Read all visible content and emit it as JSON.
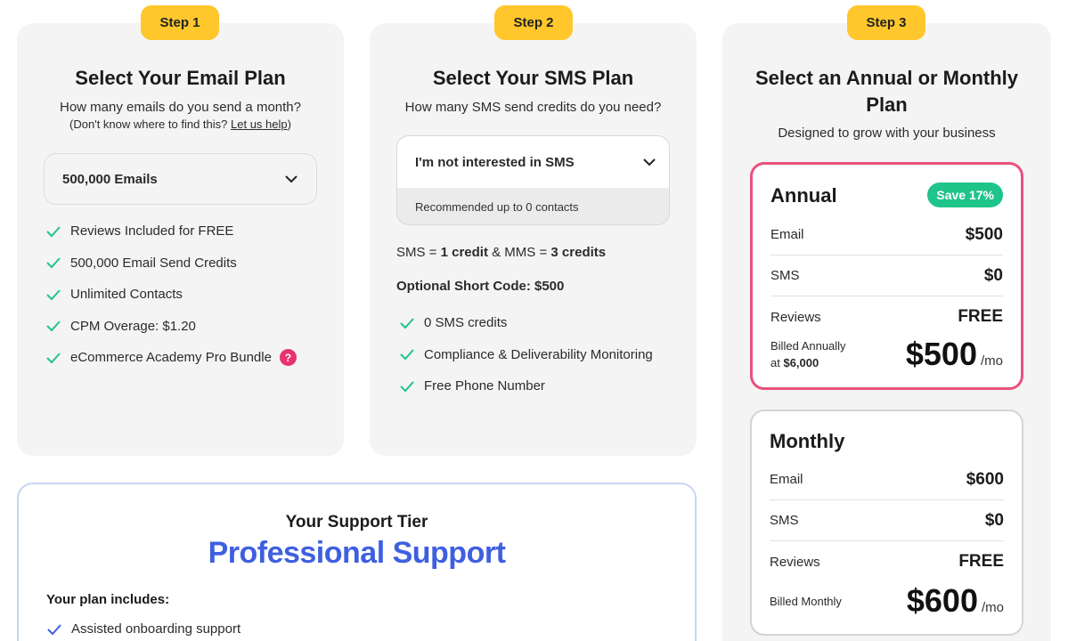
{
  "step1": {
    "badge": "Step 1",
    "title": "Select Your Email Plan",
    "subtitle": "How many emails do you send a month?",
    "help_prefix": "(Don't know where to find this?",
    "help_link": "Let us help",
    "help_suffix": ")",
    "select_value": "500,000 Emails",
    "features": [
      "Reviews Included for FREE",
      "500,000 Email Send Credits",
      "Unlimited Contacts",
      "CPM Overage: $1.20",
      "eCommerce Academy Pro Bundle"
    ],
    "info_badge": "?"
  },
  "step2": {
    "badge": "Step 2",
    "title": "Select Your SMS Plan",
    "subtitle": "How many SMS send credits do you need?",
    "select_value": "I'm not interested in SMS",
    "recommendation": "Recommended up to 0 contacts",
    "credit_sms": "SMS = ",
    "credit_sms_val": "1 credit",
    "credit_mms": " & MMS = ",
    "credit_mms_val": "3 credits",
    "short_code": "Optional Short Code: $500",
    "features": [
      "0 SMS credits",
      "Compliance & Deliverability Monitoring",
      "Free Phone Number"
    ]
  },
  "step3": {
    "badge": "Step 3",
    "title_line1": "Select an Annual or Monthly",
    "title_line2": "Plan",
    "subtitle": "Designed to grow with your business",
    "annual": {
      "name": "Annual",
      "save_badge": "Save 17%",
      "rows": [
        {
          "label": "Email",
          "value": "$500"
        },
        {
          "label": "SMS",
          "value": "$0"
        },
        {
          "label": "Reviews",
          "value": "FREE"
        }
      ],
      "billing_line1": "Billed Annually",
      "billing_line2_prefix": "at ",
      "billing_line2_value": "$6,000",
      "price": "$500",
      "per": "/mo"
    },
    "monthly": {
      "name": "Monthly",
      "rows": [
        {
          "label": "Email",
          "value": "$600"
        },
        {
          "label": "SMS",
          "value": "$0"
        },
        {
          "label": "Reviews",
          "value": "FREE"
        }
      ],
      "billing_line1": "Billed Monthly",
      "price": "$600",
      "per": "/mo"
    }
  },
  "support": {
    "subtitle": "Your Support Tier",
    "title": "Professional Support",
    "includes_label": "Your plan includes:",
    "items": [
      "Assisted onboarding support"
    ]
  },
  "colors": {
    "badge_yellow": "#ffc72c",
    "check_green": "#1fc48a",
    "annual_border": "#e8517c",
    "support_blue": "#3e5fe0",
    "support_check": "#3e5fe0"
  }
}
